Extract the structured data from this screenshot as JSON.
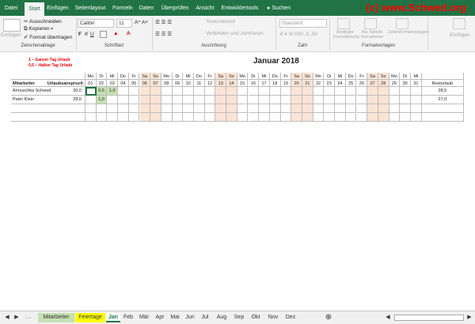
{
  "ribbon_tabs": [
    "Datei",
    "Start",
    "Einfügen",
    "Seitenlayout",
    "Formeln",
    "Daten",
    "Überprüfen",
    "Ansicht",
    "Entwicklertools",
    "Suchen"
  ],
  "watermark": "(c) www.Schwed.org",
  "clipboard": {
    "paste": "Einfügen",
    "cut": "Ausschneiden",
    "copy": "Kopieren",
    "format": "Format übertragen",
    "label": "Zwischenablage"
  },
  "font": {
    "name": "Calibri",
    "size": "11",
    "label": "Schriftart"
  },
  "alignment": {
    "wrap": "Textumbruch",
    "merge": "Verbinden und zentrieren",
    "label": "Ausrichtung"
  },
  "number": {
    "format": "Standard",
    "label": "Zahl"
  },
  "styles": {
    "conditional": "Bedingte Formatierung",
    "table": "Als Tabelle formatieren",
    "cellstyles": "Zellenformatvorlagen",
    "label": "Formatvorlagen"
  },
  "insert": {
    "label": "Einfügen"
  },
  "sheet": {
    "title": "Januar 2018",
    "legend1": "1 – Ganzer Tag Urlaub",
    "legend2": "0,5 – Halber Tag Urlaub",
    "col_employee": "Mitarbeiter",
    "col_entitlement": "Urlaubsanspruch",
    "col_rest": "Resturlaub",
    "weekdays": [
      "Mo",
      "Di",
      "Mi",
      "Do",
      "Fr",
      "Sa",
      "So",
      "Mo",
      "Di",
      "Mi",
      "Do",
      "Fr",
      "Sa",
      "So",
      "Mo",
      "Di",
      "Mi",
      "Do",
      "Fr",
      "Sa",
      "So",
      "Mo",
      "Di",
      "Mi",
      "Do",
      "Fr",
      "Sa",
      "So",
      "Mo",
      "Di",
      "Mi"
    ],
    "days": [
      "01",
      "02",
      "03",
      "04",
      "05",
      "06",
      "07",
      "08",
      "09",
      "10",
      "11",
      "12",
      "13",
      "14",
      "15",
      "16",
      "17",
      "18",
      "19",
      "20",
      "21",
      "22",
      "23",
      "24",
      "25",
      "26",
      "27",
      "28",
      "29",
      "30",
      "31"
    ],
    "rows": [
      {
        "name": "Annuschka Schwed",
        "entitlement": "30,0",
        "entries": {
          "2": "0,5",
          "3": "1,0"
        },
        "rest": "28,5"
      },
      {
        "name": "Peter Klein",
        "entitlement": "28,0",
        "entries": {
          "2": "1,0"
        },
        "rest": "27,0"
      }
    ]
  },
  "sheet_tabs": [
    "Mitarbeiter",
    "Feiertage",
    "Jan",
    "Feb",
    "Mär",
    "Apr",
    "Mai",
    "Jun",
    "Jul",
    "Aug",
    "Sep",
    "Okt",
    "Nov",
    "Dez"
  ],
  "active_sheet": "Jan",
  "colors": {
    "excel_green": "#217346",
    "weekend": "#fbe4d5",
    "entry": "#c6e0b4",
    "watermark": "#ff0000"
  }
}
